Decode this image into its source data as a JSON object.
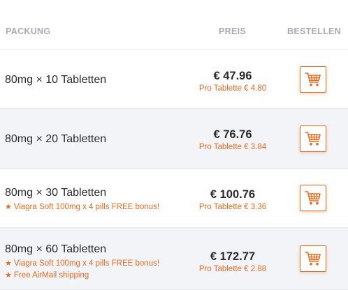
{
  "header": {
    "packung": "PACKUNG",
    "preis": "PREIS",
    "bestellen": "BESTELLEN"
  },
  "rows": [
    {
      "package": "80mg × 10 Tabletten",
      "price": "€ 47.96",
      "per_tablet": "Pro Tablette € 4.80",
      "bonuses": []
    },
    {
      "package": "80mg × 20 Tabletten",
      "price": "€ 76.76",
      "per_tablet": "Pro Tablette € 3.84",
      "bonuses": []
    },
    {
      "package": "80mg × 30 Tabletten",
      "price": "€ 100.76",
      "per_tablet": "Pro Tablette € 3.36",
      "bonuses": [
        "Viagra Soft 100mg x 4 pills FREE bonus!"
      ]
    },
    {
      "package": "80mg × 60 Tabletten",
      "price": "€ 172.77",
      "per_tablet": "Pro Tablette € 2.88",
      "bonuses": [
        "Viagra Soft 100mg x 4 pills FREE bonus!",
        "Free AirMail shipping"
      ]
    }
  ],
  "icons": {
    "bonus": "star-icon",
    "order": "shopping-cart-icon"
  },
  "colors": {
    "accent": "#ec6a1f",
    "header_text": "#a9a9b6",
    "alt_row_bg": "#f3f4f8",
    "divider": "#e6e6ea"
  }
}
